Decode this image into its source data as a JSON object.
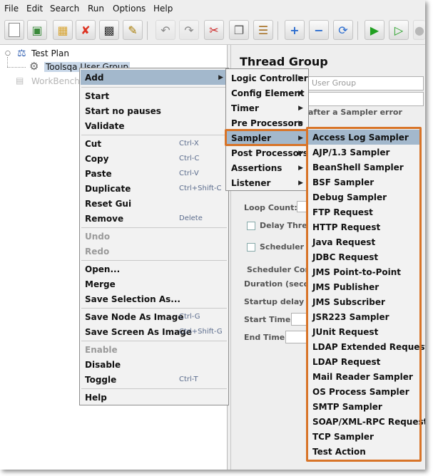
{
  "menubar": [
    "File",
    "Edit",
    "Search",
    "Run",
    "Options",
    "Help"
  ],
  "toolbar_icons": [
    "new-icon",
    "templates-icon",
    "open-icon",
    "close-icon",
    "save-icon",
    "edit-icon",
    "undo-icon",
    "redo-icon",
    "cut-icon",
    "copy-icon",
    "paste-icon",
    "expand-icon",
    "collapse-icon",
    "toggle-icon",
    "start-icon",
    "start-no-pause-icon",
    "stop-icon"
  ],
  "tree": {
    "test_plan": "Test Plan",
    "thread_group": "Toolsqa User Group",
    "workbench": "WorkBench"
  },
  "right_panel": {
    "title": "Thread Group",
    "name_value": "User Group",
    "after_error": "after a Sampler error",
    "loop_count": "Loop Count:",
    "delay_thread": "Delay Threa",
    "scheduler": "Scheduler",
    "scheduler_config": "Scheduler Con",
    "duration": "Duration (secon",
    "startup_delay": "Startup delay (s",
    "start_time": "Start Time",
    "end_time": "End Time"
  },
  "context_menu": {
    "add": "Add",
    "start": "Start",
    "start_no_pauses": "Start no pauses",
    "validate": "Validate",
    "cut": "Cut",
    "cut_sc": "Ctrl-X",
    "copy": "Copy",
    "copy_sc": "Ctrl-C",
    "paste": "Paste",
    "paste_sc": "Ctrl-V",
    "duplicate": "Duplicate",
    "duplicate_sc": "Ctrl+Shift-C",
    "reset_gui": "Reset Gui",
    "remove": "Remove",
    "remove_sc": "Delete",
    "undo": "Undo",
    "redo": "Redo",
    "open": "Open...",
    "merge": "Merge",
    "save_selection": "Save Selection As...",
    "save_node_image": "Save Node As Image",
    "save_node_image_sc": "Ctrl-G",
    "save_screen_image": "Save Screen As Image",
    "save_screen_image_sc": "Ctrl+Shift-G",
    "enable": "Enable",
    "disable": "Disable",
    "toggle": "Toggle",
    "toggle_sc": "Ctrl-T",
    "help": "Help"
  },
  "add_menu": [
    "Logic Controller",
    "Config Element",
    "Timer",
    "Pre Processors",
    "Sampler",
    "Post Processors",
    "Assertions",
    "Listener"
  ],
  "sampler_menu": [
    "Access Log Sampler",
    "AJP/1.3 Sampler",
    "BeanShell Sampler",
    "BSF Sampler",
    "Debug Sampler",
    "FTP Request",
    "HTTP Request",
    "Java Request",
    "JDBC Request",
    "JMS Point-to-Point",
    "JMS Publisher",
    "JMS Subscriber",
    "JSR223 Sampler",
    "JUnit Request",
    "LDAP Extended Request",
    "LDAP Request",
    "Mail Reader Sampler",
    "OS Process Sampler",
    "SMTP Sampler",
    "SOAP/XML-RPC Request",
    "TCP Sampler",
    "Test Action"
  ],
  "colors": {
    "highlight": "#a3b8cc",
    "callout": "#d87428",
    "menu_bg": "#f2f2f2"
  }
}
